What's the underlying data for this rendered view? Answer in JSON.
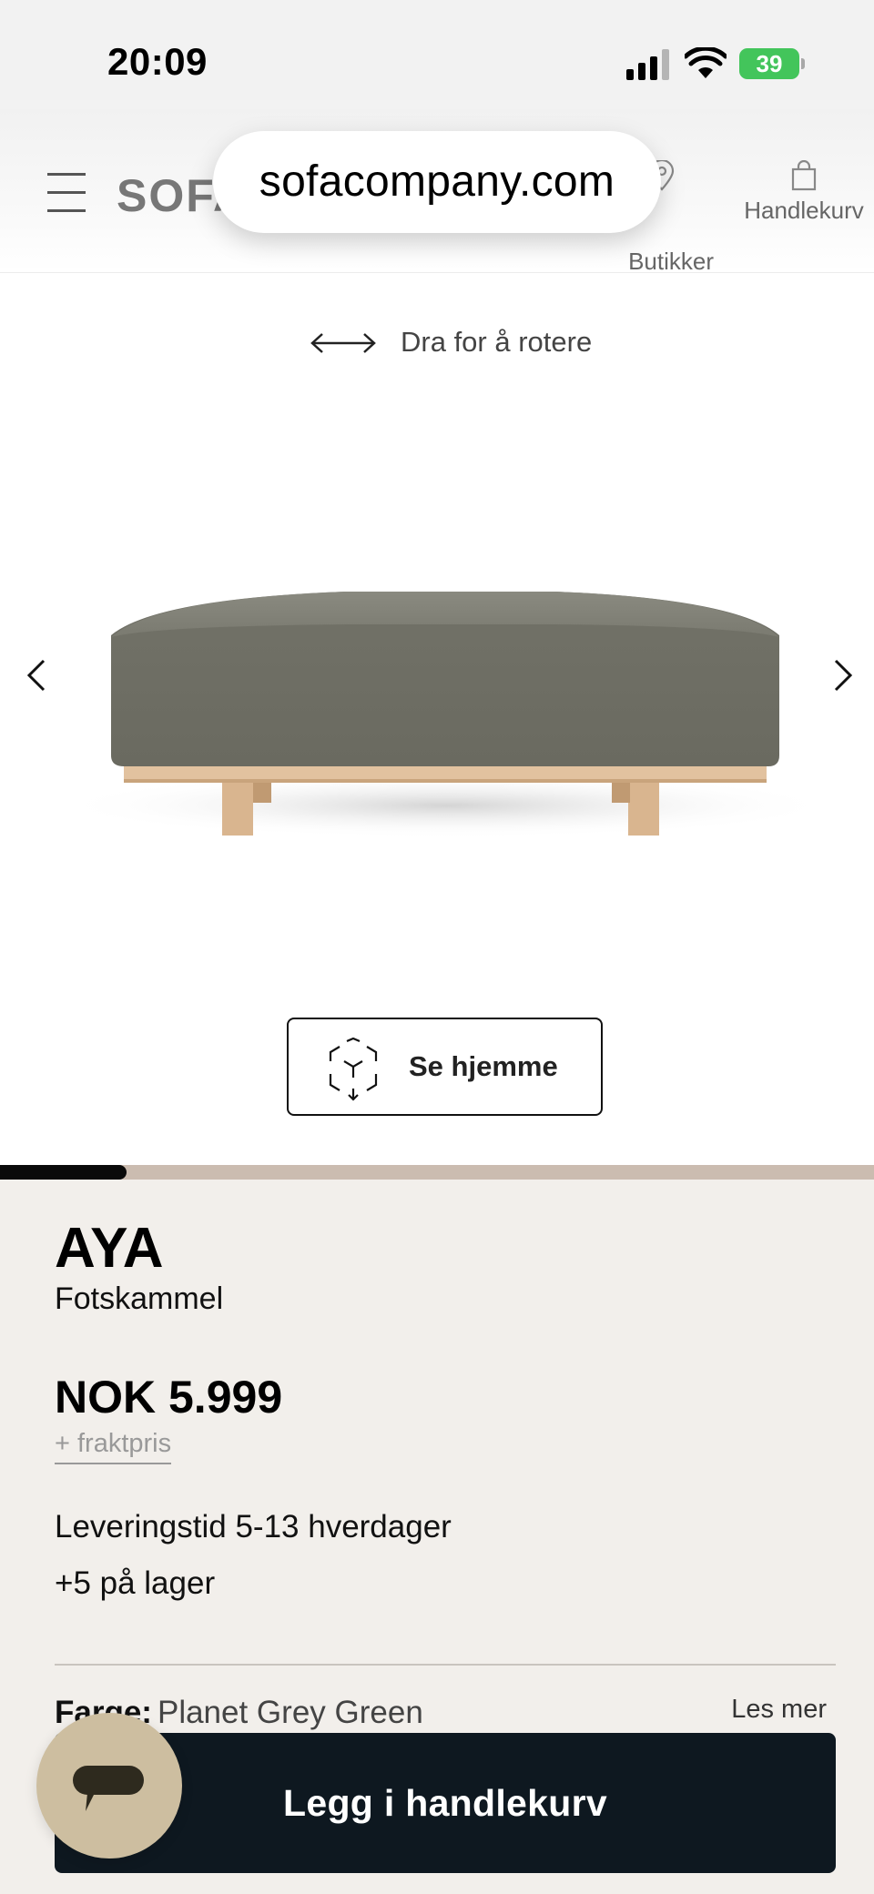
{
  "status_bar": {
    "time": "20:09",
    "battery": "39",
    "icons": [
      "cellular-signal-icon",
      "wifi-icon",
      "battery-charging-icon"
    ]
  },
  "browser": {
    "url": "sofacompany.com"
  },
  "header": {
    "brand": "SOFA",
    "store_label": "Butikker",
    "cart_label": "Handlekurv",
    "icons": [
      "hamburger-menu-icon",
      "location-pin-icon",
      "shopping-bag-icon"
    ]
  },
  "viewer": {
    "rotate_hint": "Dra for å rotere",
    "ar_button_label": "Se hjemme",
    "gallery_progress": 0.145,
    "icons": [
      "rotate-arrows-icon",
      "chevron-left-icon",
      "chevron-right-icon",
      "ar-cube-icon"
    ]
  },
  "product": {
    "name": "AYA",
    "type": "Fotskammel",
    "price": "NOK 5.999",
    "shipping_link": "+ fraktpris",
    "delivery": "Leveringstid 5-13 hverdager",
    "stock": "+5  på lager",
    "color_label": "Farge:",
    "color_value": "Planet Grey Green",
    "read_more": "Les mer"
  },
  "actions": {
    "add_to_cart": "Legg i handlekurv",
    "icons": [
      "chat-bubble-icon"
    ]
  },
  "colors": {
    "page_background": "#f2efeb",
    "viewer_background": "#ffffff",
    "cta_background": "#0e1820",
    "chat_button": "#cdbea0",
    "progress_track": "#cbbcb0",
    "progress_fill": "#0a0a0a",
    "battery_green": "#43c55b"
  }
}
